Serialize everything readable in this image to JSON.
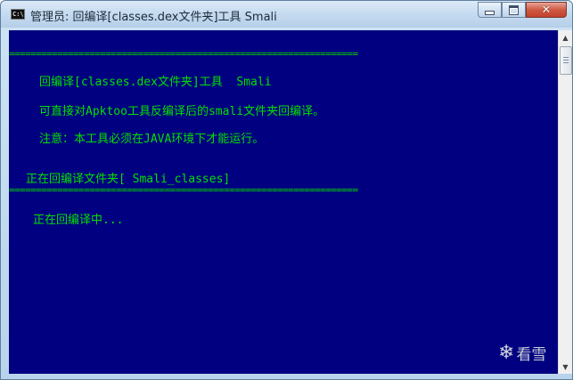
{
  "window": {
    "title": "管理员:  回编译[classes.dex文件夹]工具  Smali",
    "icon_text": "C:\\",
    "close_glyph": "✕"
  },
  "console": {
    "lines": [
      "=================================================================",
      "回编译[classes.dex文件夹]工具  Smali",
      "可直接对Apktoo工具反编译后的smali文件夹回编译。",
      "注意：本工具必须在JAVA环境下才能运行。",
      "正在回编译文件夹[ Smali_classes]",
      "=================================================================",
      "正在回编译中..."
    ]
  },
  "scrollbar": {
    "up_arrow": "▲",
    "down_arrow": "▼"
  },
  "watermark": {
    "icon": "snowflake-icon",
    "glyph": "❄",
    "text": "看雪"
  },
  "colors": {
    "console_bg": "#000080",
    "console_text": "#00e000",
    "close_button": "#c2402a"
  }
}
